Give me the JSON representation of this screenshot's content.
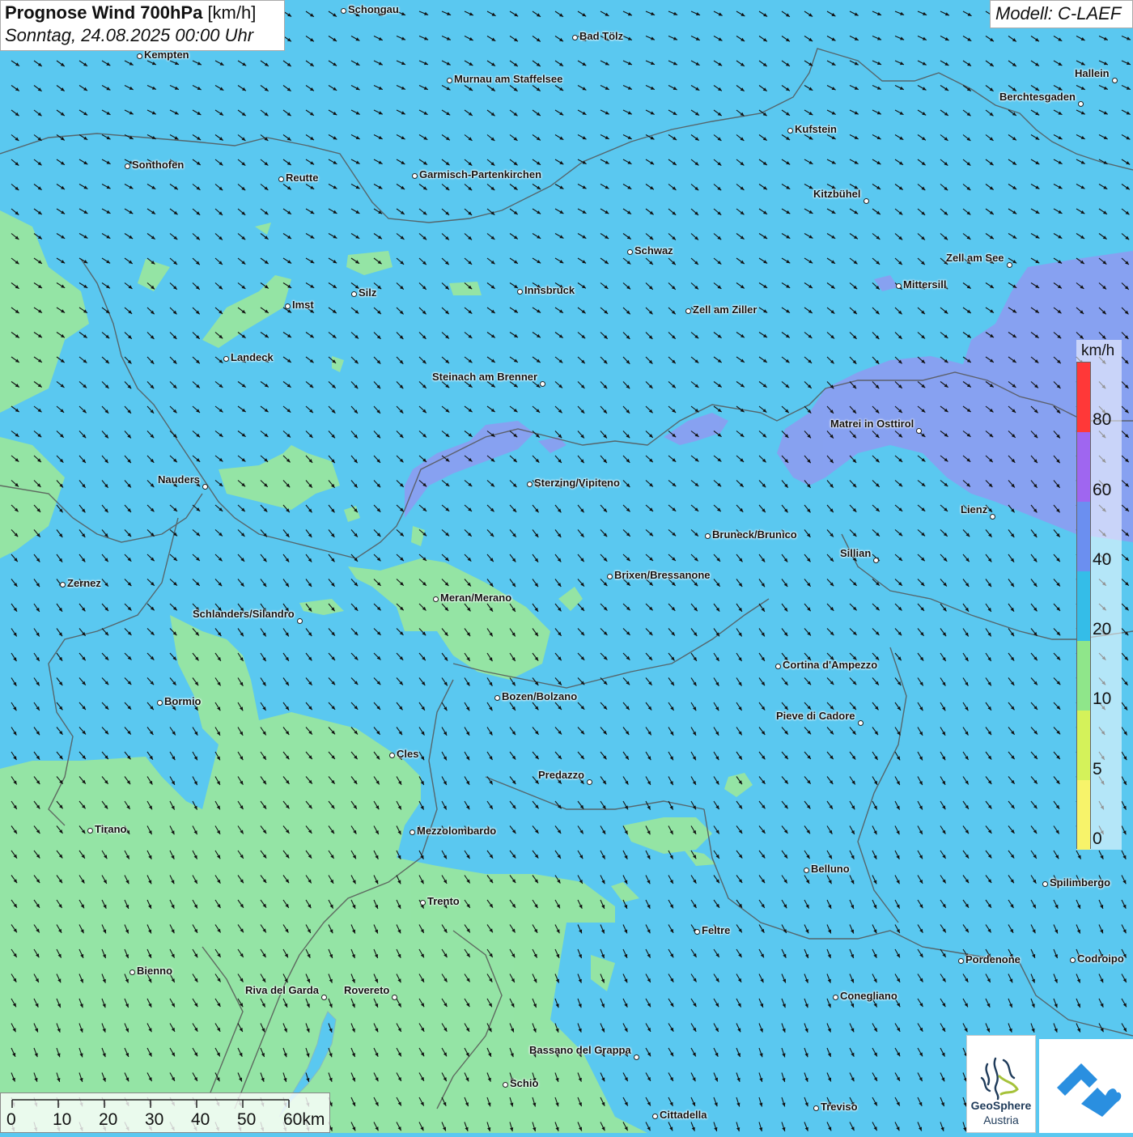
{
  "header": {
    "title_bold": "Prognose Wind 700hPa",
    "title_unit": "[km/h]",
    "datetime": "Sonntag, 24.08.2025 00:00 Uhr"
  },
  "model_label": "Modell: C-LAEF",
  "legend": {
    "unit": "km/h",
    "labels": [
      "80",
      "60",
      "40",
      "20",
      "10",
      "5",
      "0"
    ],
    "colors": [
      "#ff3838",
      "#9f66f0",
      "#6b8ff0",
      "#34bde8",
      "#8fe68a",
      "#d4f25a",
      "#f7f36a"
    ]
  },
  "scale_bar": {
    "labels": [
      "0",
      "10",
      "20",
      "30",
      "40",
      "50",
      "60km"
    ]
  },
  "logo": {
    "line1": "GeoSphere",
    "line2": "Austria"
  },
  "map_colors": {
    "background": "#5ac8f0",
    "light_wind": "#98e6a0",
    "strong_wind": "#8a9ff0",
    "borders": "#555555",
    "arrows": "#111111"
  },
  "cities": [
    {
      "name": "Schongau",
      "side": "right"
    },
    {
      "name": "Bad Tölz",
      "side": "right"
    },
    {
      "name": "Kempten",
      "side": "right"
    },
    {
      "name": "Murnau am Staffelsee",
      "side": "right"
    },
    {
      "name": "Hallein",
      "side": "left"
    },
    {
      "name": "Berchtesgaden",
      "side": "left"
    },
    {
      "name": "Kufstein",
      "side": "right"
    },
    {
      "name": "Sonthofen",
      "side": "right"
    },
    {
      "name": "Reutte",
      "side": "right"
    },
    {
      "name": "Garmisch-Partenkirchen",
      "side": "right"
    },
    {
      "name": "Kitzbühel",
      "side": "left"
    },
    {
      "name": "Schwaz",
      "side": "right"
    },
    {
      "name": "Zell am See",
      "side": "left"
    },
    {
      "name": "Mittersill",
      "side": "right"
    },
    {
      "name": "Innsbruck",
      "side": "right"
    },
    {
      "name": "Silz",
      "side": "right"
    },
    {
      "name": "Imst",
      "side": "right"
    },
    {
      "name": "Zell am Ziller",
      "side": "right"
    },
    {
      "name": "Landeck",
      "side": "right"
    },
    {
      "name": "Steinach am Brenner",
      "side": "left"
    },
    {
      "name": "Matrei in Osttirol",
      "side": "left"
    },
    {
      "name": "Nauders",
      "side": "left"
    },
    {
      "name": "Sterzing/Vipiteno",
      "side": "right"
    },
    {
      "name": "Lienz",
      "side": "left"
    },
    {
      "name": "Bruneck/Brunico",
      "side": "right"
    },
    {
      "name": "Sillian",
      "side": "left"
    },
    {
      "name": "Zernez",
      "side": "right"
    },
    {
      "name": "Brixen/Bressanone",
      "side": "right"
    },
    {
      "name": "Meran/Merano",
      "side": "right"
    },
    {
      "name": "Schlanders/Silandro",
      "side": "left"
    },
    {
      "name": "Cortina d'Ampezzo",
      "side": "right"
    },
    {
      "name": "Bozen/Bolzano",
      "side": "right"
    },
    {
      "name": "Bormio",
      "side": "right"
    },
    {
      "name": "Pieve di Cadore",
      "side": "left"
    },
    {
      "name": "Cles",
      "side": "right"
    },
    {
      "name": "Predazzo",
      "side": "left"
    },
    {
      "name": "Tirano",
      "side": "right"
    },
    {
      "name": "Mezzolombardo",
      "side": "right"
    },
    {
      "name": "Belluno",
      "side": "right"
    },
    {
      "name": "Spilimbergo",
      "side": "right"
    },
    {
      "name": "Trento",
      "side": "right"
    },
    {
      "name": "Feltre",
      "side": "right"
    },
    {
      "name": "Pordenone",
      "side": "right"
    },
    {
      "name": "Codroipo",
      "side": "right"
    },
    {
      "name": "Bienno",
      "side": "right"
    },
    {
      "name": "Riva del Garda",
      "side": "left"
    },
    {
      "name": "Rovereto",
      "side": "left"
    },
    {
      "name": "Conegliano",
      "side": "right"
    },
    {
      "name": "Bassano del Grappa",
      "side": "left"
    },
    {
      "name": "Schio",
      "side": "right"
    },
    {
      "name": "Treviso",
      "side": "right"
    },
    {
      "name": "Cittadella",
      "side": "right"
    }
  ]
}
